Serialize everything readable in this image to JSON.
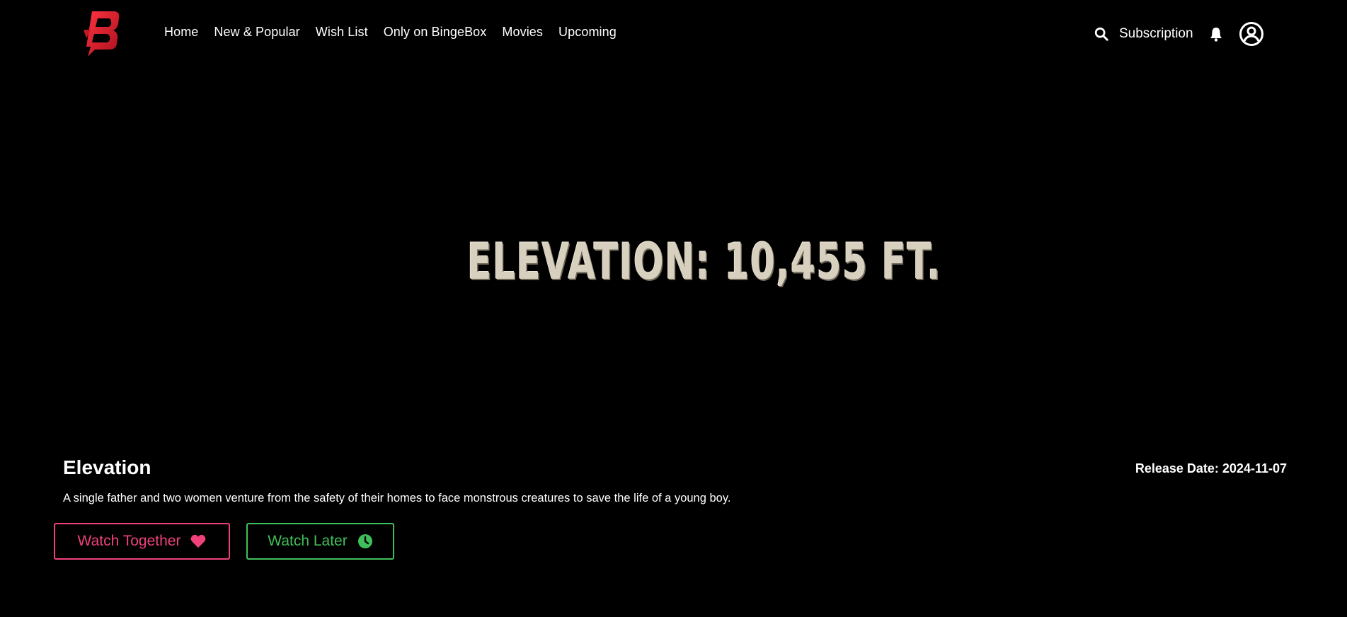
{
  "brand": {
    "logo_letter": "B",
    "logo_color": "#e8202f"
  },
  "nav": {
    "items": [
      {
        "label": "Home"
      },
      {
        "label": "New & Popular"
      },
      {
        "label": "Wish List"
      },
      {
        "label": "Only on BingeBox"
      },
      {
        "label": "Movies"
      },
      {
        "label": "Upcoming"
      }
    ],
    "subscription_label": "Subscription",
    "icons": [
      "search-icon",
      "bell-icon",
      "account-circle-icon"
    ]
  },
  "hero": {
    "title_text": "ELEVATION: 10,455 FT."
  },
  "movie": {
    "title": "Elevation",
    "release_date": "Release Date: 2024-11-07",
    "description": "A single father and two women venture from the safety of their homes to face monstrous creatures to save the life of a young boy."
  },
  "actions": {
    "watch_together": {
      "label": "Watch Together",
      "icon": "heart-icon",
      "color": "#f0417a"
    },
    "watch_later": {
      "label": "Watch Later",
      "icon": "clock-icon",
      "color": "#3fbf5a"
    }
  }
}
